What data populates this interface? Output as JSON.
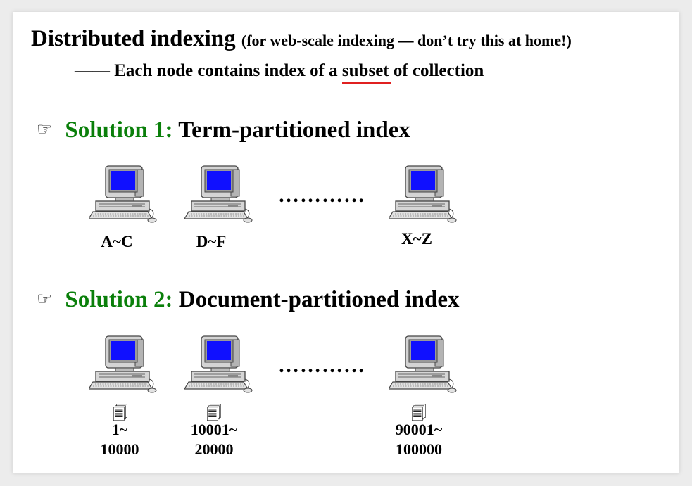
{
  "slide": {
    "title": "Distributed indexing",
    "title_note": "(for web-scale indexing — don’t try this at home!)",
    "subtitle_prefix": "—— Each node contains index of a ",
    "subtitle_emphasis": "subset",
    "subtitle_suffix": " of collection"
  },
  "solutions": [
    {
      "bullet_icon": "pointing-hand-icon",
      "label": "Solution 1:",
      "name": "Term-partitioned index",
      "ellipsis": "…………",
      "nodes": [
        {
          "range": "A~C"
        },
        {
          "range": "D~F"
        },
        {
          "range": "X~Z"
        }
      ]
    },
    {
      "bullet_icon": "pointing-hand-icon",
      "label": "Solution 2:",
      "name": "Document-partitioned index",
      "ellipsis": "…………",
      "nodes": [
        {
          "doc_icon": "documents-icon",
          "range_start": "1~",
          "range_end": "10000"
        },
        {
          "doc_icon": "documents-icon",
          "range_start": "10001~",
          "range_end": "20000"
        },
        {
          "doc_icon": "documents-icon",
          "range_start": "90001~",
          "range_end": "100000"
        }
      ]
    }
  ],
  "colors": {
    "solution_label": "#0a7f0a",
    "emphasis_underline": "#e02020",
    "screen": "#1010ff",
    "computer_body": "#d0d0d0"
  }
}
